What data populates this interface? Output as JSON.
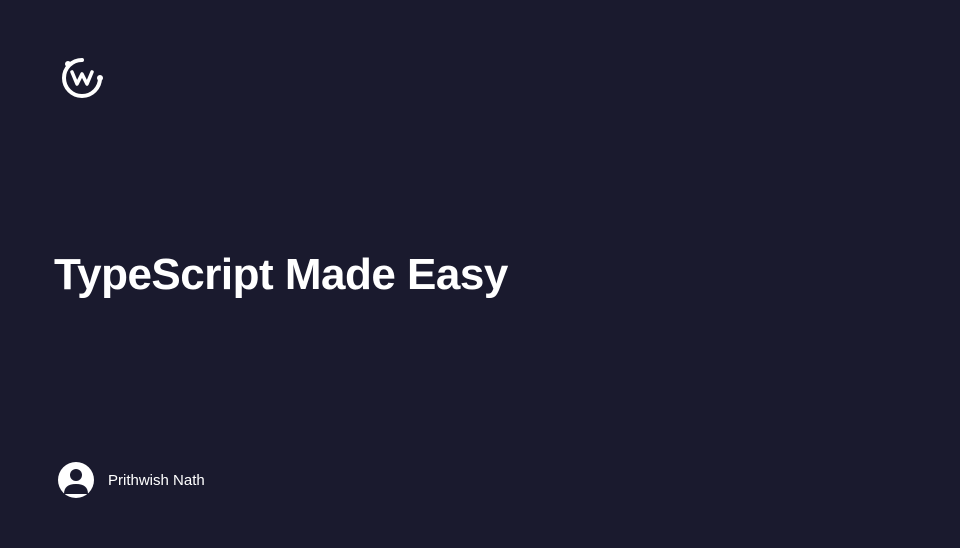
{
  "title": "TypeScript Made Easy",
  "author": {
    "name": "Prithwish Nath"
  }
}
